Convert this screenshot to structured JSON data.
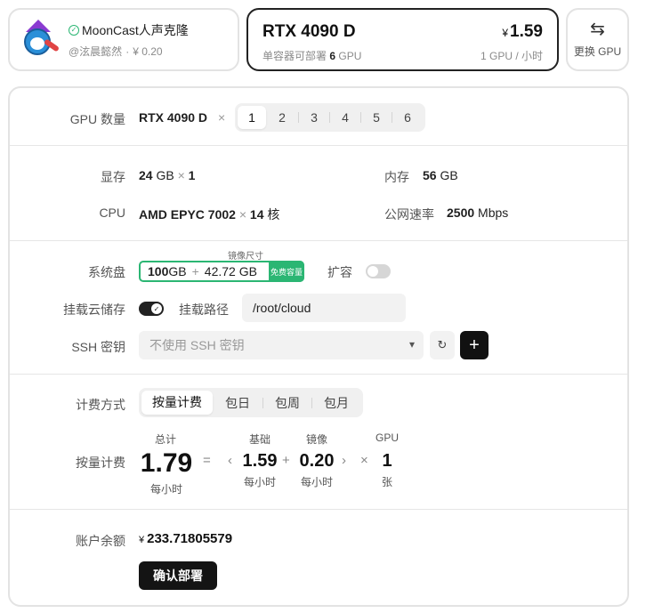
{
  "app": {
    "title": "MoonCast人声克隆",
    "author": "@泫晨懿然",
    "dot": "·",
    "price": "¥ 0.20"
  },
  "gpu_card": {
    "name": "RTX 4090 D",
    "deployable_prefix": "单容器可部署",
    "deployable_count": "6",
    "deployable_suffix": "GPU",
    "price_symbol": "¥",
    "price": "1.59",
    "price_unit": "1 GPU / 小时"
  },
  "switch_gpu": {
    "label": "更换 GPU",
    "icon": "swap-arrows-icon"
  },
  "gpu_count": {
    "label": "GPU 数量",
    "model": "RTX 4090 D",
    "times": "×",
    "options": [
      "1",
      "2",
      "3",
      "4",
      "5",
      "6"
    ],
    "selected": "1"
  },
  "specs": {
    "vram_label": "显存",
    "vram_value": "24",
    "vram_unit": "GB",
    "vram_times": "×",
    "vram_count": "1",
    "ram_label": "内存",
    "ram_value": "56",
    "ram_unit": "GB",
    "cpu_label": "CPU",
    "cpu_model": "AMD EPYC 7002",
    "cpu_times": "×",
    "cpu_cores": "14",
    "cpu_unit": "核",
    "net_label": "公网速率",
    "net_value": "2500",
    "net_unit": "Mbps"
  },
  "disk": {
    "label": "系统盘",
    "image_size_label": "镜像尺寸",
    "base": "100",
    "base_unit": "GB",
    "plus": "+",
    "image_size": "42.72 GB",
    "free_badge": "免费容量",
    "expand_label": "扩容",
    "expand_enabled": false
  },
  "mount": {
    "label": "挂载云储存",
    "enabled": true,
    "path_label": "挂载路径",
    "path_value": "/root/cloud"
  },
  "ssh": {
    "label": "SSH 密钥",
    "selected": "不使用 SSH 密钥",
    "refresh_icon": "refresh-icon",
    "add_icon": "plus-icon"
  },
  "billing": {
    "label": "计费方式",
    "options": [
      "按量计费",
      "包日",
      "包周",
      "包月"
    ],
    "selected": "按量计费"
  },
  "pay_as_you_go": {
    "label": "按量计费",
    "total_caption": "总计",
    "total": "1.79",
    "total_unit": "每小时",
    "equals": "=",
    "lt": "‹",
    "base_caption": "基础",
    "base": "1.59",
    "base_unit": "每小时",
    "plus": "+",
    "image_caption": "镜像",
    "image": "0.20",
    "image_unit": "每小时",
    "gt": "›",
    "times": "×",
    "gpu_caption": "GPU",
    "gpu_count": "1",
    "gpu_unit": "张"
  },
  "balance": {
    "label": "账户余额",
    "symbol": "¥",
    "value": "233.71805579"
  },
  "deploy_button": "确认部署",
  "colors": {
    "accent_green": "#2bb673",
    "dark": "#141414"
  }
}
